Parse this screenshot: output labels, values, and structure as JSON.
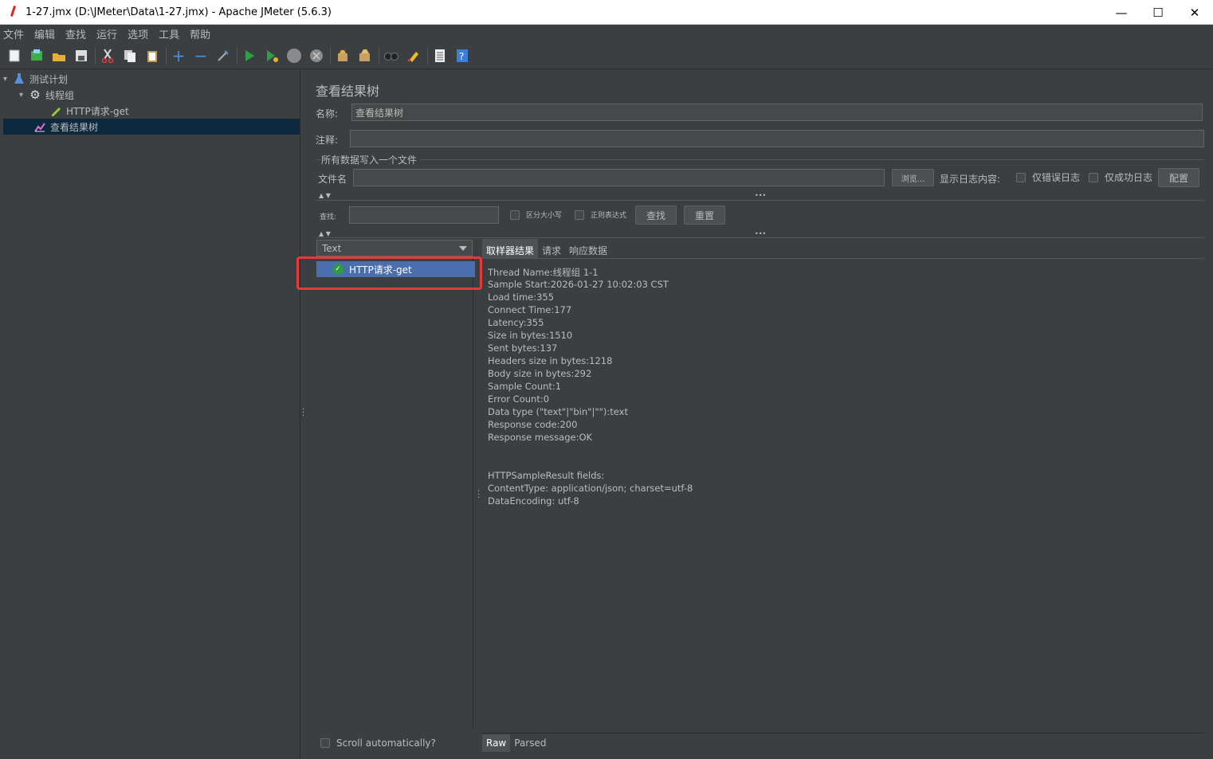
{
  "window": {
    "title": "1-27.jmx (D:\\JMeter\\Data\\1-27.jmx) - Apache JMeter (5.6.3)",
    "minimize": "—",
    "maximize": "☐",
    "close": "✕"
  },
  "menu": [
    "文件",
    "编辑",
    "查找",
    "运行",
    "选项",
    "工具",
    "帮助"
  ],
  "toolbar_icons": [
    "new-icon",
    "templates-icon",
    "open-icon",
    "save-icon",
    "cut-icon",
    "copy-icon",
    "paste-icon",
    "expand-icon",
    "collapse-icon",
    "toggle-icon",
    "start-icon",
    "start-no-pause-icon",
    "stop-icon",
    "shutdown-icon",
    "clear-icon",
    "clear-all-icon",
    "search-icon",
    "reset-search-icon",
    "function-helper-icon",
    "help-icon"
  ],
  "tree": {
    "test_plan": "测试计划",
    "thread_group": "线程组",
    "http_request": "HTTP请求-get",
    "view_results_tree": "查看结果树"
  },
  "panel": {
    "title": "查看结果树",
    "name_label": "名称:",
    "name_value": "查看结果树",
    "comment_label": "注释:",
    "comment_value": "",
    "file_section_title": "所有数据写入一个文件",
    "filename_label": "文件名",
    "filename_value": "",
    "browse_button": "浏览...",
    "log_display_label": "显示日志内容:",
    "errors_only": "仅错误日志",
    "success_only": "仅成功日志",
    "configure_button": "配置"
  },
  "search": {
    "label": "查找:",
    "value": "",
    "case_sensitive": "区分大小写",
    "regex": "正则表达式",
    "find_button": "查找",
    "reset_button": "重置"
  },
  "results": {
    "renderer": "Text",
    "items": [
      "HTTP请求-get"
    ],
    "scroll_auto": "Scroll automatically?"
  },
  "tabs": [
    "取样器结果",
    "请求",
    "响应数据"
  ],
  "sampler_result": [
    "Thread Name:线程组 1-1",
    "Sample Start:2026-01-27 10:02:03 CST",
    "Load time:355",
    "Connect Time:177",
    "Latency:355",
    "Size in bytes:1510",
    "Sent bytes:137",
    "Headers size in bytes:1218",
    "Body size in bytes:292",
    "Sample Count:1",
    "Error Count:0",
    "Data type (\"text\"|\"bin\"|\"\"):text",
    "Response code:200",
    "Response message:OK",
    "",
    "",
    "HTTPSampleResult fields:",
    "ContentType: application/json; charset=utf-8",
    "DataEncoding: utf-8"
  ],
  "bottom_tabs": [
    "Raw",
    "Parsed"
  ],
  "colors": {
    "background": "#3c3f41",
    "selection": "#4b6eaf",
    "tree_selection": "#0d293e",
    "highlight": "#e03c3c",
    "success": "#2e9a43"
  }
}
